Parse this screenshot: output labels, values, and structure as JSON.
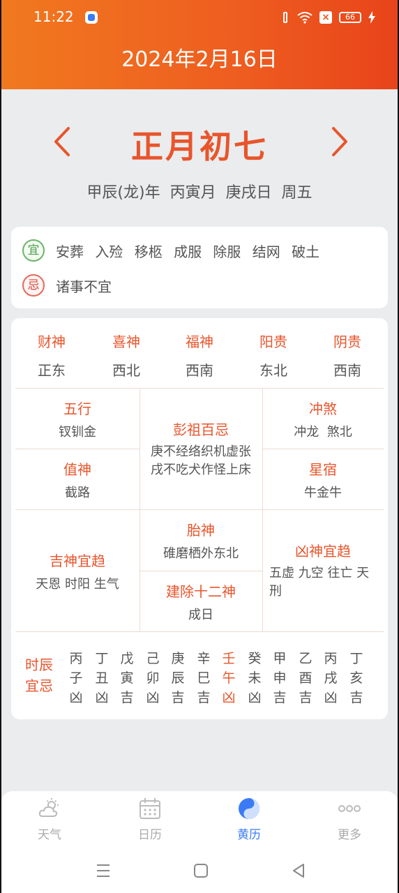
{
  "status_bar": {
    "time": "11:22",
    "battery": "66"
  },
  "header": {
    "date": "2024年2月16日"
  },
  "lunar": {
    "title": "正月初七",
    "ganzhi": "甲辰(龙)年  丙寅月  庚戌日  周五"
  },
  "yiji": {
    "yi_badge": "宜",
    "yi_items": "安葬 入殓 移柩 成服 除服 结网 破土",
    "ji_badge": "忌",
    "ji_items": "诸事不宜"
  },
  "gods": [
    {
      "name": "财神",
      "dir": "正东"
    },
    {
      "name": "喜神",
      "dir": "西北"
    },
    {
      "name": "福神",
      "dir": "西南"
    },
    {
      "name": "阳贵",
      "dir": "东北"
    },
    {
      "name": "阴贵",
      "dir": "西南"
    }
  ],
  "grid": {
    "wuxing": {
      "title": "五行",
      "value": "钗钏金"
    },
    "pengzu": {
      "title": "彭祖百忌",
      "line1": "庚不经络织机虚张",
      "line2": "戌不吃犬作怪上床"
    },
    "chongsha": {
      "title": "冲煞",
      "value": "冲龙  煞北"
    },
    "zhishen": {
      "title": "值神",
      "value": "截路"
    },
    "xingxiu": {
      "title": "星宿",
      "value": "牛金牛"
    },
    "jishen": {
      "title": "吉神宜趋",
      "value": "天恩 时阳 生气"
    },
    "taishen": {
      "title": "胎神",
      "value": "碓磨栖外东北"
    },
    "jianchu": {
      "title": "建除十二神",
      "value": "成日"
    },
    "xiongshen": {
      "title": "凶神宜趋",
      "line1": "五虚 九空 往亡 天",
      "line2": "刑"
    }
  },
  "hours": {
    "label_line1": "时辰",
    "label_line2": "宜忌",
    "items": [
      {
        "gan": "丙",
        "zhi": "子",
        "luck": "凶"
      },
      {
        "gan": "丁",
        "zhi": "丑",
        "luck": "凶"
      },
      {
        "gan": "戊",
        "zhi": "寅",
        "luck": "吉"
      },
      {
        "gan": "己",
        "zhi": "卯",
        "luck": "凶"
      },
      {
        "gan": "庚",
        "zhi": "辰",
        "luck": "吉"
      },
      {
        "gan": "辛",
        "zhi": "巳",
        "luck": "吉"
      },
      {
        "gan": "壬",
        "zhi": "午",
        "luck": "凶"
      },
      {
        "gan": "癸",
        "zhi": "未",
        "luck": "凶"
      },
      {
        "gan": "甲",
        "zhi": "申",
        "luck": "吉"
      },
      {
        "gan": "乙",
        "zhi": "酉",
        "luck": "吉"
      },
      {
        "gan": "丙",
        "zhi": "戌",
        "luck": "凶"
      },
      {
        "gan": "丁",
        "zhi": "亥",
        "luck": "吉"
      }
    ]
  },
  "nav": [
    {
      "label": "天气",
      "icon": "weather-icon"
    },
    {
      "label": "日历",
      "icon": "calendar-icon"
    },
    {
      "label": "黄历",
      "icon": "yin-yang-icon"
    },
    {
      "label": "更多",
      "icon": "more-icon"
    }
  ],
  "colors": {
    "accent": "#e8552c",
    "header_start": "#f0791f",
    "header_end": "#e8441a",
    "active_nav": "#3a7bf5"
  }
}
